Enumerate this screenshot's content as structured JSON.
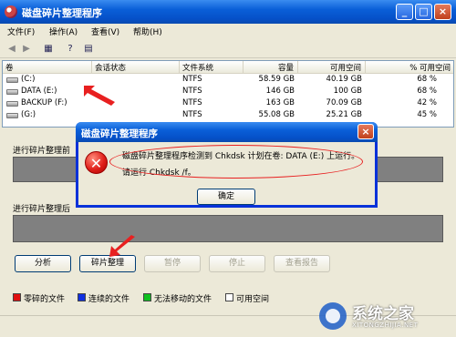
{
  "window": {
    "title": "磁盘碎片整理程序",
    "controls": [
      "_",
      "□",
      "×"
    ]
  },
  "menu": [
    "文件(F)",
    "操作(A)",
    "查看(V)",
    "帮助(H)"
  ],
  "toolbar_icons": [
    "back-arrow-icon",
    "forward-arrow-icon",
    "list-view-icon",
    "help-icon",
    "properties-icon"
  ],
  "volume_list": {
    "columns": [
      "卷",
      "会话状态",
      "文件系统",
      "容量",
      "可用空间",
      "% 可用空间"
    ],
    "rows": [
      {
        "name": "(C:)",
        "status": "",
        "fs": "NTFS",
        "capacity": "58.59 GB",
        "free": "40.19 GB",
        "pct": "68 %"
      },
      {
        "name": "DATA (E:)",
        "status": "",
        "fs": "NTFS",
        "capacity": "146 GB",
        "free": "100 GB",
        "pct": "68 %"
      },
      {
        "name": "BACKUP (F:)",
        "status": "",
        "fs": "NTFS",
        "capacity": "163 GB",
        "free": "70.09 GB",
        "pct": "42 %"
      },
      {
        "name": "(G:)",
        "status": "",
        "fs": "NTFS",
        "capacity": "55.08 GB",
        "free": "25.21 GB",
        "pct": "45 %"
      }
    ]
  },
  "panels": {
    "before_label": "进行碎片整理前",
    "after_label": "进行碎片整理后"
  },
  "buttons": {
    "analyze": "分析",
    "defragment": "碎片整理",
    "pause": "暂停",
    "stop": "停止",
    "view_report": "查看报告"
  },
  "legend": [
    {
      "label": "零碎的文件",
      "color": "#e01010"
    },
    {
      "label": "连续的文件",
      "color": "#1030e0"
    },
    {
      "label": "无法移动的文件",
      "color": "#10c020"
    },
    {
      "label": "可用空间",
      "color": "#ffffff"
    }
  ],
  "dialog": {
    "title": "磁盘碎片整理程序",
    "message_line1": "磁盘碎片整理程序检测到 Chkdsk 计划在卷: DATA (E:) 上运行。",
    "message_line2": "请运行 Chkdsk /f。",
    "ok": "确定"
  },
  "watermark": {
    "brand": "系统之家",
    "url": "XITONGZHIJIA.NET"
  },
  "colors": {
    "accent_blue": "#0a5fd8",
    "annotation_red": "#e82020"
  }
}
